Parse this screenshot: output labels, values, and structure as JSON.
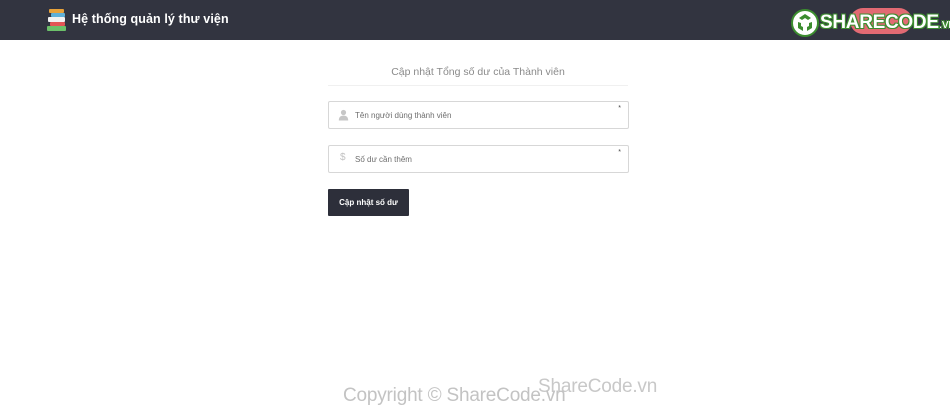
{
  "header": {
    "title": "Hệ thống quản lý thư viện",
    "logo_icon": "books-icon"
  },
  "watermark": {
    "logo_main": "SHARECODE",
    "logo_suffix": ".vn",
    "site": "ShareCode.vn",
    "copyright": "Copyright © ShareCode.vn"
  },
  "form": {
    "heading": "Cập nhật Tổng số dư của Thành viên",
    "username_placeholder": "Tên người dùng thành viên",
    "amount_placeholder": "Số dư cần thêm",
    "required_mark": "*",
    "dollar_glyph": "$",
    "submit_label": "Cập nhật số dư"
  },
  "colors": {
    "navbar": "#323440",
    "button": "#2d2f3a",
    "logout_pill": "#e26a73",
    "logo_green": "#3c8d2f"
  }
}
